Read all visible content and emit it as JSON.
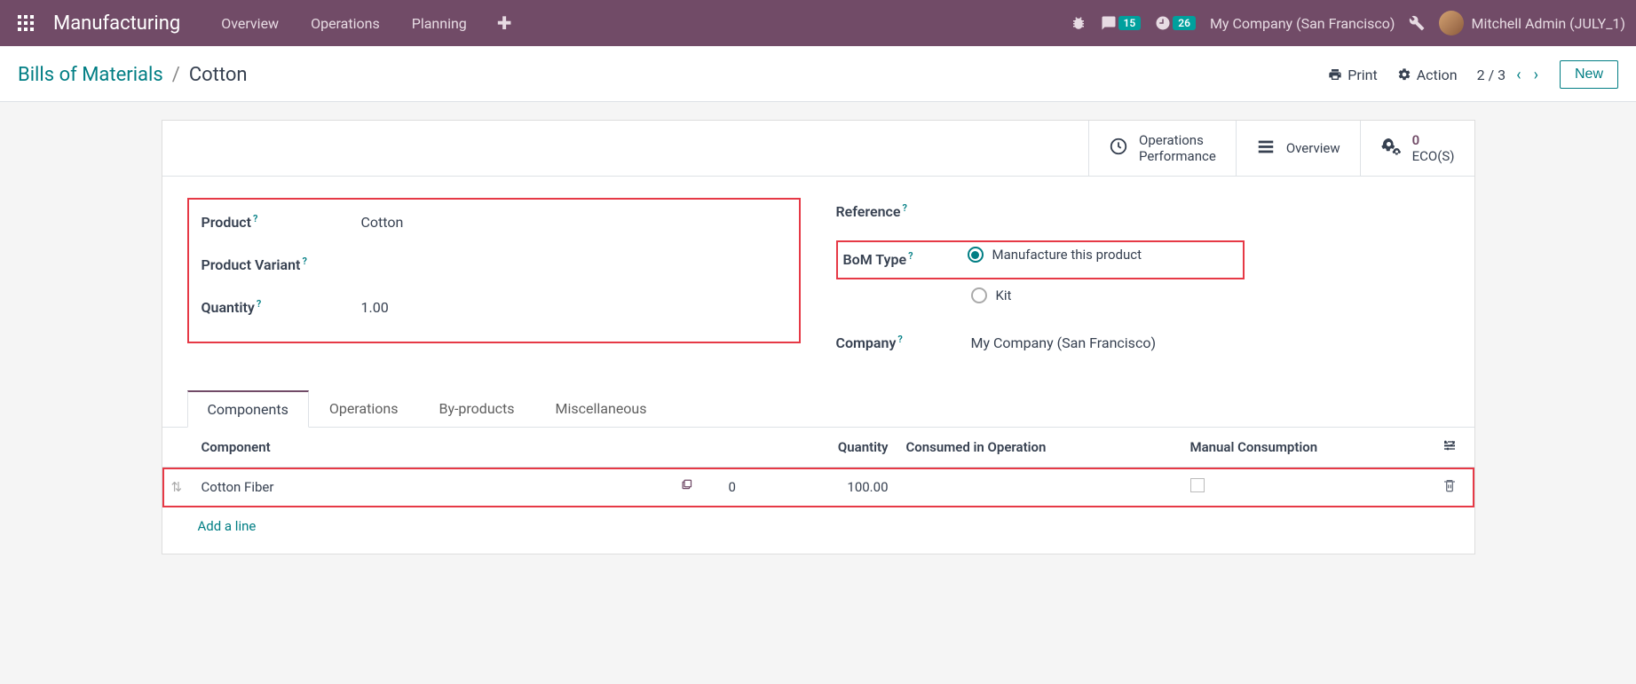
{
  "navbar": {
    "brand": "Manufacturing",
    "items": [
      "Overview",
      "Operations",
      "Planning"
    ],
    "messages_badge": "15",
    "activities_badge": "26",
    "company": "My Company (San Francisco)",
    "user": "Mitchell Admin (JULY_1)"
  },
  "control_panel": {
    "breadcrumb_root": "Bills of Materials",
    "breadcrumb_current": "Cotton",
    "print_label": "Print",
    "action_label": "Action",
    "pager": "2 / 3",
    "new_label": "New"
  },
  "stat_buttons": {
    "ops_perf_line1": "Operations",
    "ops_perf_line2": "Performance",
    "overview": "Overview",
    "ecos_count": "0",
    "ecos_label": "ECO(S)"
  },
  "form": {
    "labels": {
      "product": "Product",
      "product_variant": "Product Variant",
      "quantity": "Quantity",
      "reference": "Reference",
      "bom_type": "BoM Type",
      "company": "Company"
    },
    "values": {
      "product": "Cotton",
      "product_variant": "",
      "quantity": "1.00",
      "reference": "",
      "company": "My Company (San Francisco)"
    },
    "bom_type_options": {
      "manufacture": "Manufacture this product",
      "kit": "Kit"
    },
    "bom_type_selected": "manufacture"
  },
  "tabs": [
    "Components",
    "Operations",
    "By-products",
    "Miscellaneous"
  ],
  "active_tab": 0,
  "components_table": {
    "headers": {
      "component": "Component",
      "quantity": "Quantity",
      "consumed_in": "Consumed in Operation",
      "manual": "Manual Consumption"
    },
    "rows": [
      {
        "component": "Cotton Fiber",
        "forecast": "0",
        "quantity": "100.00",
        "consumed_in": "",
        "manual": false
      }
    ],
    "add_line": "Add a line"
  }
}
